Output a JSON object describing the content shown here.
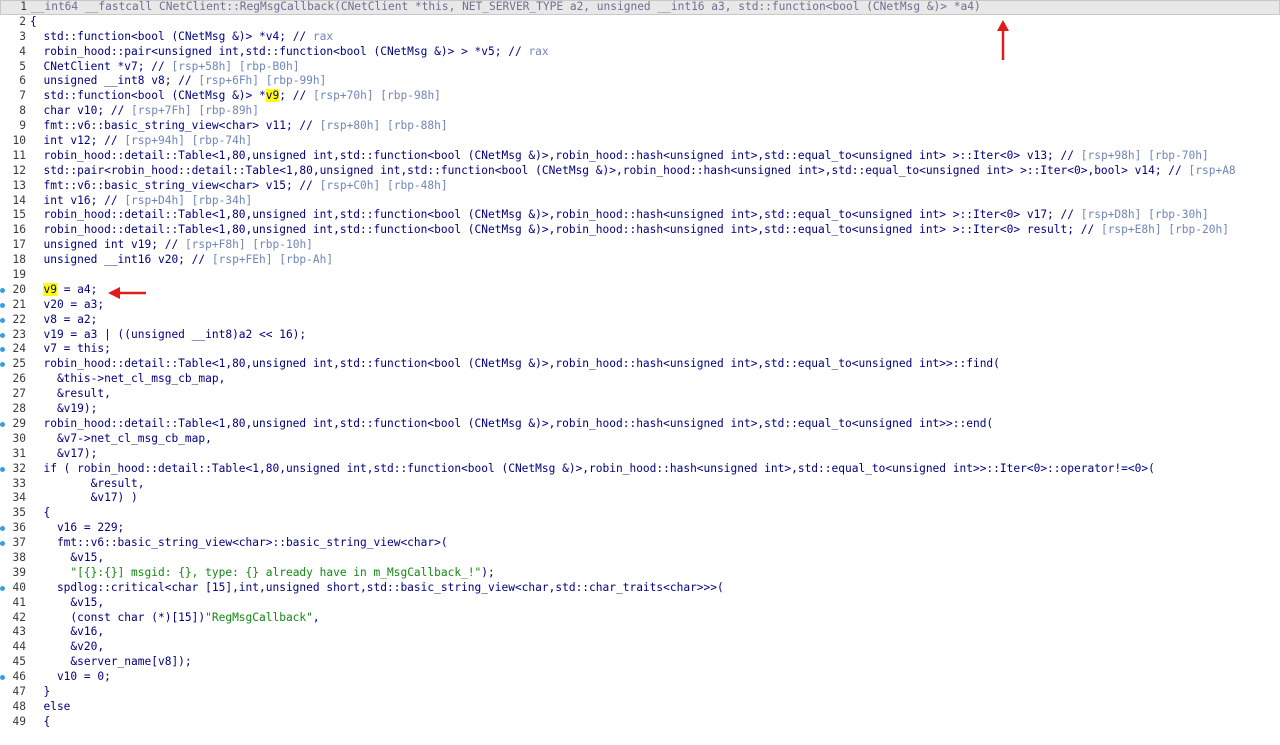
{
  "lines": [
    {
      "n": "1",
      "text": "__int64 __fastcall CNetClient::RegMsgCallback(CNetClient *this, NET_SERVER_TYPE a2, unsigned __int16 a3, std::function<bool (CNetMsg &)> *a4)",
      "current": true
    },
    {
      "n": "2",
      "text": "{"
    },
    {
      "n": "3",
      "text": "  std::function<bool (CNetMsg &)> *v4; // rax"
    },
    {
      "n": "4",
      "text": "  robin_hood::pair<unsigned int,std::function<bool (CNetMsg &)> > *v5; // rax"
    },
    {
      "n": "5",
      "text": "  CNetClient *v7; // [rsp+58h] [rbp-B0h]"
    },
    {
      "n": "6",
      "text": "  unsigned __int8 v8; // [rsp+6Fh] [rbp-99h]"
    },
    {
      "n": "7",
      "text": "  std::function<bool (CNetMsg &)> *v9; // [rsp+70h] [rbp-98h]",
      "hl": "v9"
    },
    {
      "n": "8",
      "text": "  char v10; // [rsp+7Fh] [rbp-89h]"
    },
    {
      "n": "9",
      "text": "  fmt::v6::basic_string_view<char> v11; // [rsp+80h] [rbp-88h]"
    },
    {
      "n": "10",
      "text": "  int v12; // [rsp+94h] [rbp-74h]"
    },
    {
      "n": "11",
      "text": "  robin_hood::detail::Table<1,80,unsigned int,std::function<bool (CNetMsg &)>,robin_hood::hash<unsigned int>,std::equal_to<unsigned int> >::Iter<0> v13; // [rsp+98h] [rbp-70h]"
    },
    {
      "n": "12",
      "text": "  std::pair<robin_hood::detail::Table<1,80,unsigned int,std::function<bool (CNetMsg &)>,robin_hood::hash<unsigned int>,std::equal_to<unsigned int> >::Iter<0>,bool> v14; // [rsp+A8"
    },
    {
      "n": "13",
      "text": "  fmt::v6::basic_string_view<char> v15; // [rsp+C0h] [rbp-48h]"
    },
    {
      "n": "14",
      "text": "  int v16; // [rsp+D4h] [rbp-34h]"
    },
    {
      "n": "15",
      "text": "  robin_hood::detail::Table<1,80,unsigned int,std::function<bool (CNetMsg &)>,robin_hood::hash<unsigned int>,std::equal_to<unsigned int> >::Iter<0> v17; // [rsp+D8h] [rbp-30h]"
    },
    {
      "n": "16",
      "text": "  robin_hood::detail::Table<1,80,unsigned int,std::function<bool (CNetMsg &)>,robin_hood::hash<unsigned int>,std::equal_to<unsigned int> >::Iter<0> result; // [rsp+E8h] [rbp-20h]"
    },
    {
      "n": "17",
      "text": "  unsigned int v19; // [rsp+F8h] [rbp-10h]"
    },
    {
      "n": "18",
      "text": "  unsigned __int16 v20; // [rsp+FEh] [rbp-Ah]"
    },
    {
      "n": "19",
      "text": ""
    },
    {
      "n": "20",
      "text": "  v9 = a4;",
      "hl": "v9",
      "bp": true
    },
    {
      "n": "21",
      "text": "  v20 = a3;",
      "bp": true
    },
    {
      "n": "22",
      "text": "  v8 = a2;",
      "bp": true
    },
    {
      "n": "23",
      "text": "  v19 = a3 | ((unsigned __int8)a2 << 16);",
      "bp": true
    },
    {
      "n": "24",
      "text": "  v7 = this;",
      "bp": true
    },
    {
      "n": "25",
      "text": "  robin_hood::detail::Table<1,80,unsigned int,std::function<bool (CNetMsg &)>,robin_hood::hash<unsigned int>,std::equal_to<unsigned int>>::find(",
      "bp": true
    },
    {
      "n": "26",
      "text": "    &this->net_cl_msg_cb_map,"
    },
    {
      "n": "27",
      "text": "    &result,"
    },
    {
      "n": "28",
      "text": "    &v19);"
    },
    {
      "n": "29",
      "text": "  robin_hood::detail::Table<1,80,unsigned int,std::function<bool (CNetMsg &)>,robin_hood::hash<unsigned int>,std::equal_to<unsigned int>>::end(",
      "bp": true
    },
    {
      "n": "30",
      "text": "    &v7->net_cl_msg_cb_map,"
    },
    {
      "n": "31",
      "text": "    &v17);"
    },
    {
      "n": "32",
      "text": "  if ( robin_hood::detail::Table<1,80,unsigned int,std::function<bool (CNetMsg &)>,robin_hood::hash<unsigned int>,std::equal_to<unsigned int>>::Iter<0>::operator!=<0>(",
      "bp": true
    },
    {
      "n": "33",
      "text": "         &result,"
    },
    {
      "n": "34",
      "text": "         &v17) )"
    },
    {
      "n": "35",
      "text": "  {"
    },
    {
      "n": "36",
      "text": "    v16 = 229;",
      "bp": true
    },
    {
      "n": "37",
      "text": "    fmt::v6::basic_string_view<char>::basic_string_view<char>(",
      "bp": true
    },
    {
      "n": "38",
      "text": "      &v15,"
    },
    {
      "n": "39",
      "text": "      \"[{}:{}] msgid: {}, type: {} already have in m_MsgCallback_!\");"
    },
    {
      "n": "40",
      "text": "    spdlog::critical<char [15],int,unsigned short,std::basic_string_view<char,std::char_traits<char>>>(",
      "bp": true
    },
    {
      "n": "41",
      "text": "      &v15,"
    },
    {
      "n": "42",
      "text": "      (const char (*)[15])\"RegMsgCallback\","
    },
    {
      "n": "43",
      "text": "      &v16,"
    },
    {
      "n": "44",
      "text": "      &v20,"
    },
    {
      "n": "45",
      "text": "      &server_name[v8]);"
    },
    {
      "n": "46",
      "text": "    v10 = 0;",
      "bp": true
    },
    {
      "n": "47",
      "text": "  }"
    },
    {
      "n": "48",
      "text": "  else"
    },
    {
      "n": "49",
      "text": "  {"
    }
  ],
  "colors": {
    "code": "#000080",
    "comment": "#6f86b8",
    "string": "#118811",
    "highlight": "#ffff00",
    "arrow": "#e01b1b",
    "breakpoint": "#3d9de0",
    "linenum": "#3a3a3a"
  }
}
